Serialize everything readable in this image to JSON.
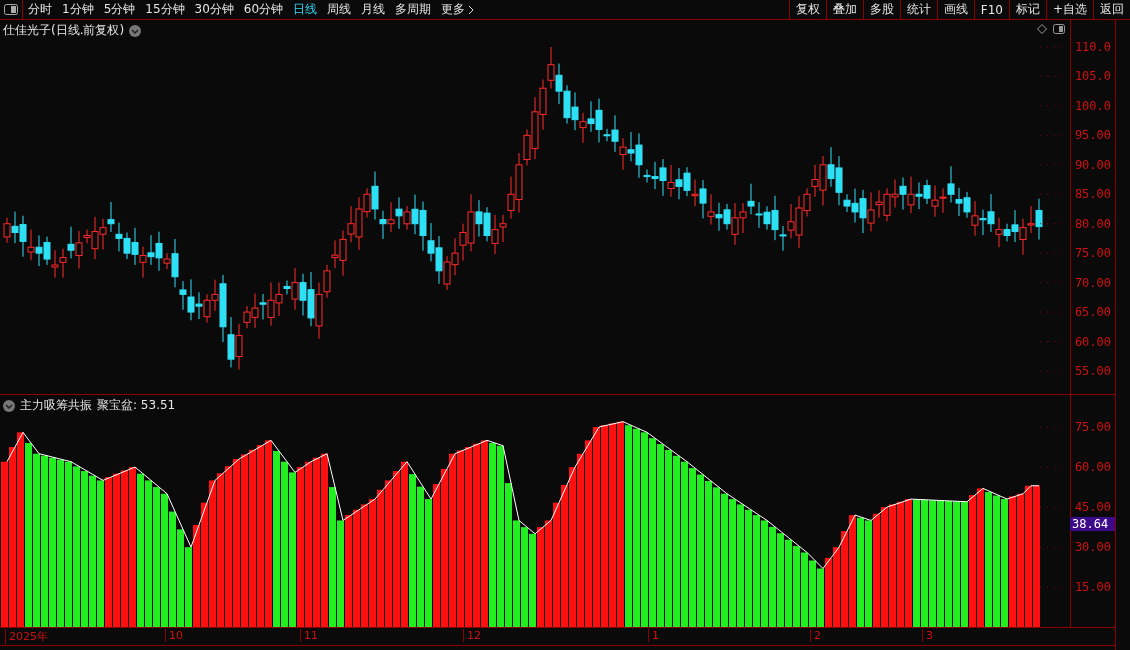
{
  "toolbar": {
    "periods": [
      {
        "label": "分时",
        "selected": false
      },
      {
        "label": "1分钟",
        "selected": false
      },
      {
        "label": "5分钟",
        "selected": false
      },
      {
        "label": "15分钟",
        "selected": false
      },
      {
        "label": "30分钟",
        "selected": false
      },
      {
        "label": "60分钟",
        "selected": false
      },
      {
        "label": "日线",
        "selected": true
      },
      {
        "label": "周线",
        "selected": false
      },
      {
        "label": "月线",
        "selected": false
      },
      {
        "label": "多周期",
        "selected": false
      },
      {
        "label": "更多",
        "selected": false
      }
    ],
    "actions": [
      "复权",
      "叠加",
      "多股",
      "统计",
      "画线",
      "F10",
      "标记",
      "+自选",
      "返回"
    ]
  },
  "main_chart": {
    "title": "仕佳光子(日线.前复权)",
    "y_axis": [
      "110.0",
      "105.0",
      "100.0",
      "95.00",
      "90.00",
      "85.00",
      "80.00",
      "75.00",
      "70.00",
      "65.00",
      "60.00",
      "55.00"
    ]
  },
  "indicator": {
    "title": "主力吸筹共振",
    "reading": "聚宝盆: 53.51",
    "y_axis": [
      "75.00",
      "60.00",
      "45.00",
      "30.00",
      "15.00"
    ],
    "price_tag": "38.64"
  },
  "date_axis": [
    "2025年",
    "10",
    "11",
    "12",
    "1",
    "2",
    "3"
  ]
}
